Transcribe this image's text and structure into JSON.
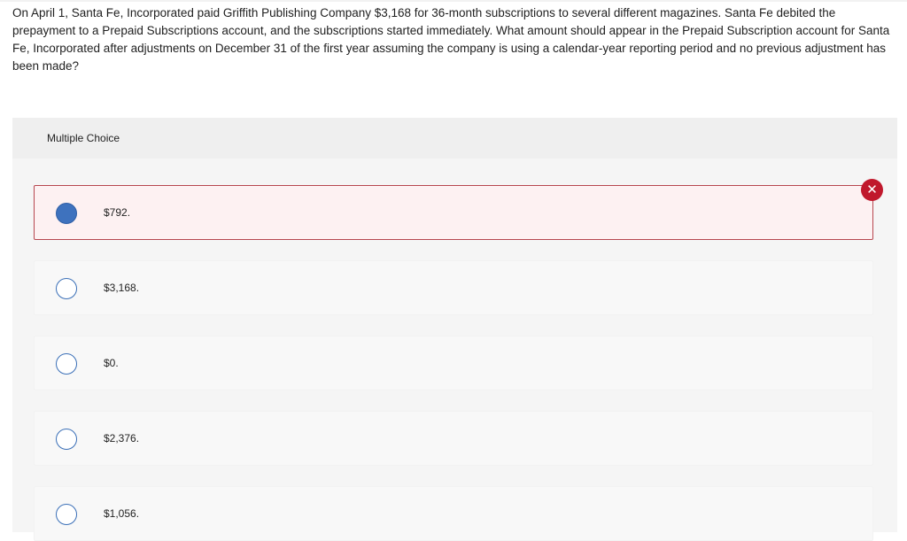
{
  "question": {
    "text": "On April 1, Santa Fe, Incorporated paid Griffith Publishing Company $3,168 for 36-month subscriptions to several different magazines. Santa Fe debited the prepayment to a Prepaid Subscriptions account, and the subscriptions started immediately. What amount should appear in the Prepaid Subscription account for Santa Fe, Incorporated after adjustments on December 31 of the first year assuming the company is using a calendar-year reporting period and no previous adjustment has been made?"
  },
  "multiple_choice": {
    "header": "Multiple Choice",
    "options": [
      {
        "label": "$792.",
        "selected": true,
        "result": "incorrect"
      },
      {
        "label": "$3,168.",
        "selected": false
      },
      {
        "label": "$0.",
        "selected": false
      },
      {
        "label": "$2,376.",
        "selected": false
      },
      {
        "label": "$1,056.",
        "selected": false
      }
    ]
  },
  "feedback": {
    "icon": "incorrect-x-icon",
    "color": "#c0182c"
  },
  "colors": {
    "radio_border": "#3a6fb7",
    "radio_selected_fill": "#3e72be",
    "selected_option_border": "#b7474f",
    "selected_option_bg": "#fdf1f2"
  }
}
